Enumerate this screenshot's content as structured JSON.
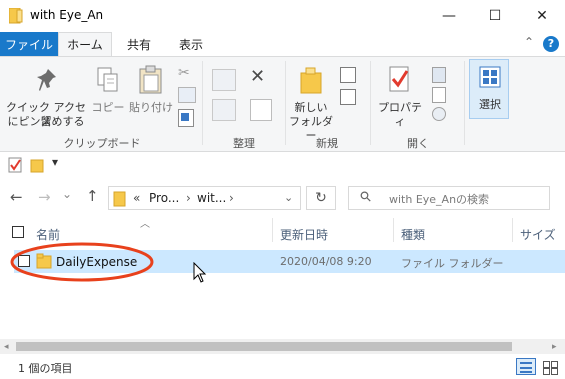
{
  "window": {
    "title": "with Eye_An",
    "minimize_glyph": "—",
    "maximize_glyph": "☐",
    "close_glyph": "✕"
  },
  "ribbon_tabs": [
    {
      "label": "ファイル"
    },
    {
      "label": "ホーム"
    },
    {
      "label": "共有"
    },
    {
      "label": "表示"
    }
  ],
  "ribbon": {
    "collapse_glyph": "⌃",
    "help_glyph": "?",
    "clipboard": {
      "pin_label_1": "クイック アクセス",
      "pin_label_2": "にピン留めする",
      "copy_label": "コピー",
      "paste_label": "貼り付け",
      "group_label": "クリップボード"
    },
    "organize": {
      "group_label": "整理"
    },
    "new": {
      "new_folder_label_1": "新しい",
      "new_folder_label_2": "フォルダー",
      "group_label": "新規"
    },
    "open": {
      "properties_label": "プロパティ",
      "group_label": "開く"
    },
    "select": {
      "label": "選択"
    }
  },
  "qat": {
    "dropdown_glyph": "▾"
  },
  "navigation": {
    "back_glyph": "←",
    "forward_glyph": "→",
    "recent_glyph": "⌄",
    "up_glyph": "↑",
    "address_parts": [
      "«",
      "Pro...",
      "›",
      "wit...",
      "›"
    ],
    "address_dropdown_glyph": "⌄",
    "refresh_glyph": "↻",
    "search_icon_glyph": "⚲",
    "search_placeholder": "with Eye_Anの検索"
  },
  "file_list": {
    "sort_glyph": "︿",
    "columns": [
      "名前",
      "更新日時",
      "種類",
      "サイズ"
    ],
    "rows": [
      {
        "name": "DailyExpense",
        "modified": "2020/04/08 9:20",
        "type": "ファイル フォルダー"
      }
    ]
  },
  "status_bar": {
    "item_count": "1 個の項目"
  },
  "colors": {
    "accent": "#1979ca",
    "selection": "#cce8ff",
    "annotation": "#e8411c",
    "folder": "#f6c84a"
  }
}
